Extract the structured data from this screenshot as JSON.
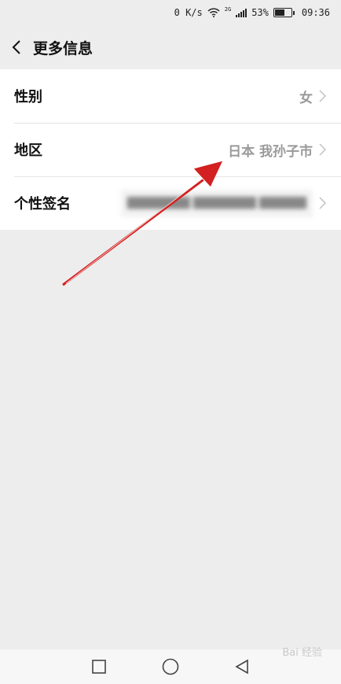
{
  "status_bar": {
    "speed": "0 K/s",
    "network": "2G",
    "battery": "53%",
    "time": "09:36"
  },
  "header": {
    "back_icon": "chevron-left-icon",
    "title": "更多信息"
  },
  "rows": [
    {
      "label": "性别",
      "value": "女"
    },
    {
      "label": "地区",
      "value": "日本 我孙子市"
    },
    {
      "label": "个性签名",
      "value": ""
    }
  ],
  "annotation": {
    "type": "red-arrow",
    "color": "#d32020"
  },
  "nav_bar": {
    "buttons": [
      "recent-apps-icon",
      "home-icon",
      "back-triangle-icon"
    ]
  },
  "watermark": "Bai 经验"
}
